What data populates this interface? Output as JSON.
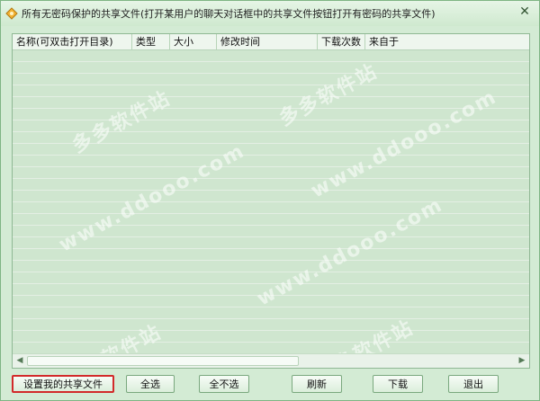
{
  "window": {
    "title": "所有无密码保护的共享文件(打开某用户的聊天对话框中的共享文件按钮打开有密码的共享文件)",
    "close_glyph": "✕"
  },
  "table": {
    "columns": [
      "名称(可双击打开目录)",
      "类型",
      "大小",
      "修改时间",
      "下载次数",
      "来自于"
    ],
    "rows": []
  },
  "scrollbar": {
    "left_arrow": "◀",
    "right_arrow": "▶"
  },
  "buttons": {
    "set_share": "设置我的共享文件",
    "select_all": "全选",
    "select_none": "全不选",
    "refresh": "刷新",
    "download": "下载",
    "exit": "退出"
  },
  "watermark": {
    "text1": "多多软件站",
    "text2": "www.ddooo.com"
  },
  "colors": {
    "background": "#d3ebd4",
    "highlight_border": "#d22a2a"
  }
}
